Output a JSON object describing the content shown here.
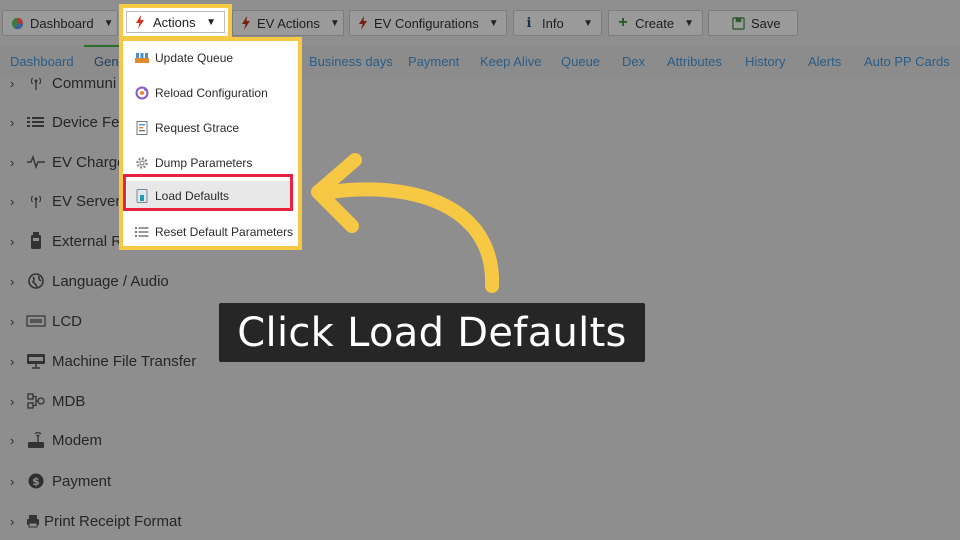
{
  "toolbar": {
    "buttons": [
      {
        "label": "Dashboard",
        "icon": "pie-chart-icon"
      },
      {
        "label": "Actions",
        "icon": "bolt-icon"
      },
      {
        "label": "EV Actions",
        "icon": "bolt-icon"
      },
      {
        "label": "EV Configurations",
        "icon": "bolt-icon"
      },
      {
        "label": "Info",
        "icon": "info-icon"
      },
      {
        "label": "Create",
        "icon": "plus-icon"
      },
      {
        "label": "Save",
        "icon": "save-icon"
      }
    ]
  },
  "tabs": [
    "Dashboard",
    "Gen",
    "Business days",
    "Payment",
    "Keep Alive",
    "Queue",
    "Dex",
    "Attributes",
    "History",
    "Alerts",
    "Auto PP Cards"
  ],
  "tree": {
    "items": [
      {
        "label": "Communi",
        "icon": "antenna-icon"
      },
      {
        "label": "Device Fe",
        "icon": "list-icon"
      },
      {
        "label": "EV Charge",
        "icon": "pulse-icon"
      },
      {
        "label": "EV Server",
        "icon": "antenna-icon"
      },
      {
        "label": "External R",
        "icon": "device-icon"
      },
      {
        "label": "Language / Audio",
        "icon": "globe-icon"
      },
      {
        "label": "LCD",
        "icon": "lcd-icon"
      },
      {
        "label": "Machine File Transfer",
        "icon": "ftp-icon"
      },
      {
        "label": "MDB",
        "icon": "mdb-icon"
      },
      {
        "label": "Modem",
        "icon": "modem-icon"
      },
      {
        "label": "Payment",
        "icon": "dollar-icon"
      },
      {
        "label": "Print Receipt Format",
        "icon": "printer-icon"
      }
    ]
  },
  "menu": {
    "items": [
      {
        "label": "Update Queue",
        "icon": "queue-icon"
      },
      {
        "label": "Reload Configuration",
        "icon": "reload-icon"
      },
      {
        "label": "Request Gtrace",
        "icon": "gtrace-icon"
      },
      {
        "label": "Dump Parameters",
        "icon": "gear-icon"
      },
      {
        "label": "Load Defaults",
        "icon": "load-icon"
      },
      {
        "label": "Reset Default Parameters",
        "icon": "list-icon"
      }
    ]
  },
  "callout": {
    "text": "Click Load Defaults"
  },
  "colors": {
    "highlight": "#f7c844",
    "selection": "#e8233f",
    "callout_bg": "#262626"
  }
}
